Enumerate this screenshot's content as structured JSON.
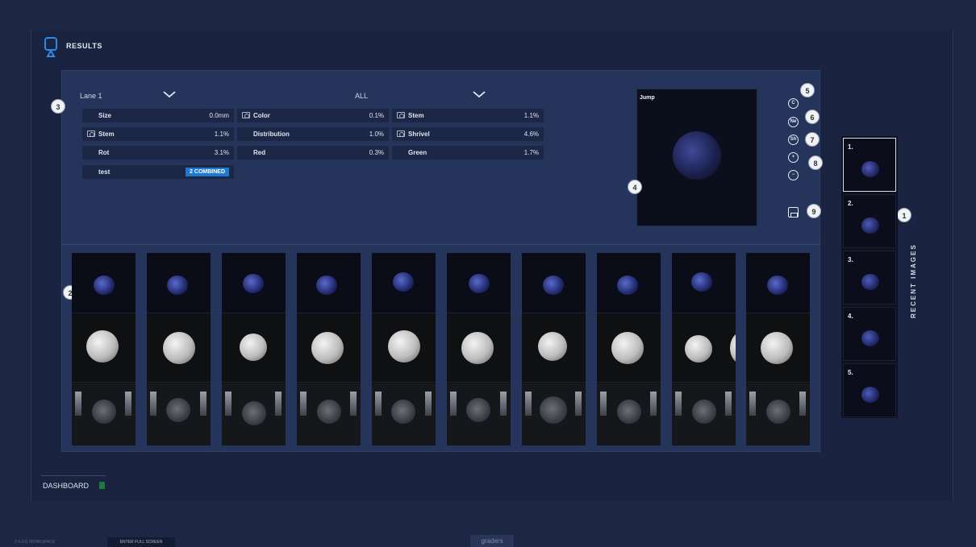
{
  "header": {
    "title": "RESULTS",
    "icon": "results-icon"
  },
  "filters": {
    "lane": "Lane 1",
    "category": "ALL"
  },
  "metrics": [
    {
      "name": "Size",
      "value": "0.0mm",
      "camera": false
    },
    {
      "name": "Color",
      "value": "0.1%",
      "camera": true
    },
    {
      "name": "Stem",
      "value": "1.1%",
      "camera": true
    },
    {
      "name": "Stem",
      "value": "1.1%",
      "camera": true
    },
    {
      "name": "Distribution",
      "value": "1.0%",
      "camera": false
    },
    {
      "name": "Shrivel",
      "value": "4.6%",
      "camera": true
    },
    {
      "name": "Rot",
      "value": "3.1%",
      "camera": false
    },
    {
      "name": "Red",
      "value": "0.3%",
      "camera": false
    },
    {
      "name": "Green",
      "value": "1.7%",
      "camera": false
    },
    {
      "name": "test",
      "value": "2 COMBINED",
      "camera": false
    }
  ],
  "preview": {
    "title": "Jump"
  },
  "controls": [
    {
      "label": "C",
      "icon": "color-mode-icon"
    },
    {
      "label": "Ne",
      "icon": "ne-mode-icon"
    },
    {
      "label": "Sh",
      "icon": "shrivel-mode-icon"
    },
    {
      "label": "+",
      "icon": "zoom-in-icon"
    },
    {
      "label": "−",
      "icon": "zoom-out-icon"
    }
  ],
  "callouts": [
    "1",
    "2",
    "3",
    "4",
    "5",
    "6",
    "7",
    "8",
    "9"
  ],
  "recent_images": {
    "title": "RECENT IMAGES",
    "items": [
      "1.",
      "2.",
      "3.",
      "4.",
      "5."
    ]
  },
  "footer": {
    "dashboard": "DASHBOARD",
    "version": "2.4.101 WORKSPACE",
    "fullscreen": "ENTER FULL SCREEN",
    "brand": "graders"
  },
  "colors": {
    "background": "#1d2744",
    "panel": "#24345a",
    "accent": "#1e78d2",
    "dashboard_indicator": "#1e7a3c"
  }
}
